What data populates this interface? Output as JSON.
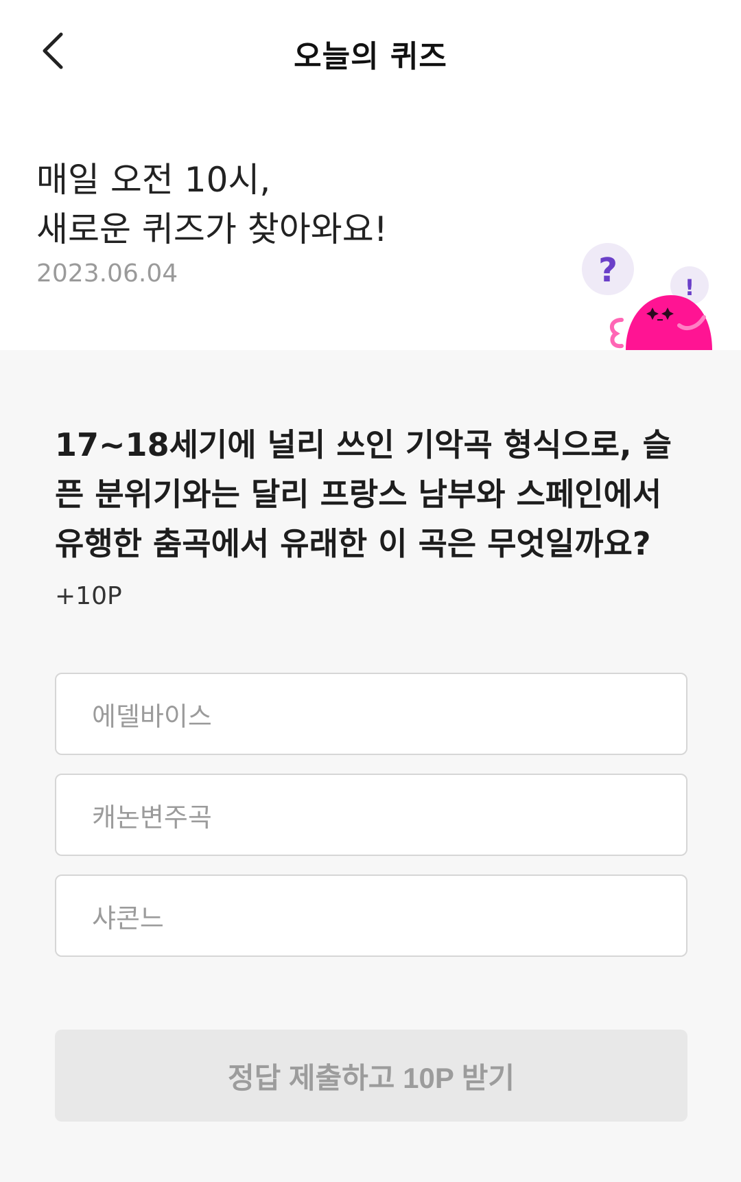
{
  "header": {
    "title": "오늘의 퀴즈"
  },
  "intro": {
    "headline_line1": "매일 오전 10시,",
    "headline_line2": "새로운 퀴즈가 찾아와요!",
    "date": "2023.06.04"
  },
  "mascot": {
    "question_mark": "?",
    "exclamation_mark": "!",
    "colors": {
      "body": "#ff1493",
      "bubble": "#efeaf7",
      "mark": "#6a3fc8"
    }
  },
  "question": {
    "text": "17~18세기에 널리 쓰인 기악곡 형식으로, 슬픈 분위기와는 달리 프랑스 남부와 스페인에서 유행한 춤곡에서 유래한 이 곡은 무엇일까요?",
    "points": "+10P"
  },
  "options": [
    {
      "label": "에델바이스"
    },
    {
      "label": "캐논변주곡"
    },
    {
      "label": "샤콘느"
    }
  ],
  "submit": {
    "label": "정답 제출하고 10P 받기"
  }
}
